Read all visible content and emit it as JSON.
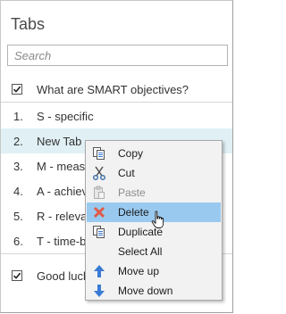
{
  "panel": {
    "title": "Tabs",
    "search_placeholder": "Search"
  },
  "list": {
    "header": {
      "checked": true,
      "label": "What are SMART objectives?"
    },
    "items": [
      {
        "num": "1.",
        "label": "S - specific"
      },
      {
        "num": "2.",
        "label": "New Tab"
      },
      {
        "num": "3.",
        "label": "M - meas"
      },
      {
        "num": "4.",
        "label": "A - achiev"
      },
      {
        "num": "5.",
        "label": "R - releva"
      },
      {
        "num": "6.",
        "label": "T - time-b"
      }
    ],
    "footer": {
      "checked": true,
      "label": "Good luck"
    }
  },
  "context_menu": {
    "items": [
      {
        "label": "Copy",
        "icon": "copy-icon"
      },
      {
        "label": "Cut",
        "icon": "scissors-icon"
      },
      {
        "label": "Paste",
        "icon": "paste-icon",
        "disabled": true
      },
      {
        "label": "Delete",
        "icon": "delete-x-icon",
        "highlighted": true
      },
      {
        "label": "Duplicate",
        "icon": "duplicate-icon"
      },
      {
        "label": "Select All",
        "icon": ""
      },
      {
        "label": "Move up",
        "icon": "arrow-up-icon"
      },
      {
        "label": "Move down",
        "icon": "arrow-down-icon"
      }
    ]
  },
  "colors": {
    "selected_row": "#e0f0f4",
    "menu_highlight": "#99c9ef",
    "arrow_blue": "#3a7bd5",
    "delete_red": "#e05a47"
  }
}
